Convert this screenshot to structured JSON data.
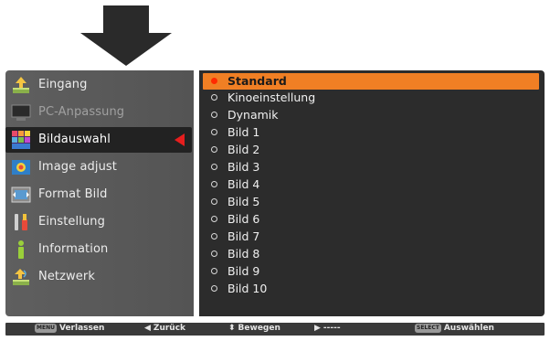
{
  "menu": {
    "items": [
      {
        "label": "Eingang",
        "icon": "input-icon",
        "disabled": false
      },
      {
        "label": "PC-Anpassung",
        "icon": "monitor-icon",
        "disabled": true
      },
      {
        "label": "Bildauswahl",
        "icon": "image-select-icon",
        "disabled": false
      },
      {
        "label": "Image adjust",
        "icon": "image-adjust-icon",
        "disabled": false
      },
      {
        "label": "Format Bild",
        "icon": "screen-format-icon",
        "disabled": false
      },
      {
        "label": "Einstellung",
        "icon": "setting-icon",
        "disabled": false
      },
      {
        "label": "Information",
        "icon": "information-icon",
        "disabled": false
      },
      {
        "label": "Netzwerk",
        "icon": "network-icon",
        "disabled": false
      }
    ],
    "selected_index": 2
  },
  "options": {
    "items": [
      "Standard",
      "Kinoeinstellung",
      "Dynamik",
      "Bild 1",
      "Bild 2",
      "Bild 3",
      "Bild 4",
      "Bild 5",
      "Bild 6",
      "Bild 7",
      "Bild 8",
      "Bild 9",
      "Bild 10"
    ],
    "active_index": 0
  },
  "statusbar": {
    "exit_key": "MENU",
    "exit": "Verlassen",
    "back": "Zurück",
    "move": "Bewegen",
    "next": "-----",
    "select_key": "SELECT",
    "select": "Auswählen"
  },
  "colors": {
    "highlight": "#f07f24",
    "marker": "#e61e1e"
  }
}
